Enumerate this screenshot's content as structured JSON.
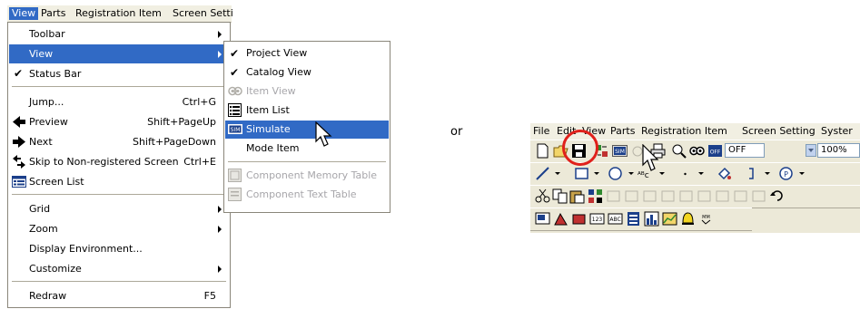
{
  "menubar": {
    "items": [
      "View",
      "Parts",
      "Registration Item",
      "Screen Setti"
    ]
  },
  "view_menu": {
    "toolbar": "Toolbar",
    "view": "View",
    "status_bar": "Status Bar",
    "jump": "Jump...",
    "jump_shortcut": "Ctrl+G",
    "preview": "Preview",
    "preview_shortcut": "Shift+PageUp",
    "next": "Next",
    "next_shortcut": "Shift+PageDown",
    "skip": "Skip to Non-registered Screen",
    "skip_shortcut": "Ctrl+E",
    "screen_list": "Screen List",
    "grid": "Grid",
    "zoom": "Zoom",
    "display_environment": "Display Environment...",
    "customize": "Customize",
    "redraw": "Redraw",
    "redraw_shortcut": "F5"
  },
  "view_submenu": {
    "project_view": "Project View",
    "catalog_view": "Catalog View",
    "item_view": "Item View",
    "item_list": "Item List",
    "simulate": "Simulate",
    "mode_item": "Mode Item",
    "component_memory_table": "Component Memory Table",
    "component_text_table": "Component Text Table"
  },
  "or_text": "or",
  "right_window": {
    "menu_items": [
      "File",
      "Edit",
      "View",
      "Parts",
      "Registration Item",
      "Screen Setting",
      "Syster"
    ],
    "off_combo": "OFF",
    "zoom_combo": "100%"
  },
  "colors": {
    "highlight": "#316ac5",
    "menubar_bg": "#f1efe2",
    "toolbar_bg": "#ece9d8",
    "annotation_circle": "#e0201b"
  }
}
